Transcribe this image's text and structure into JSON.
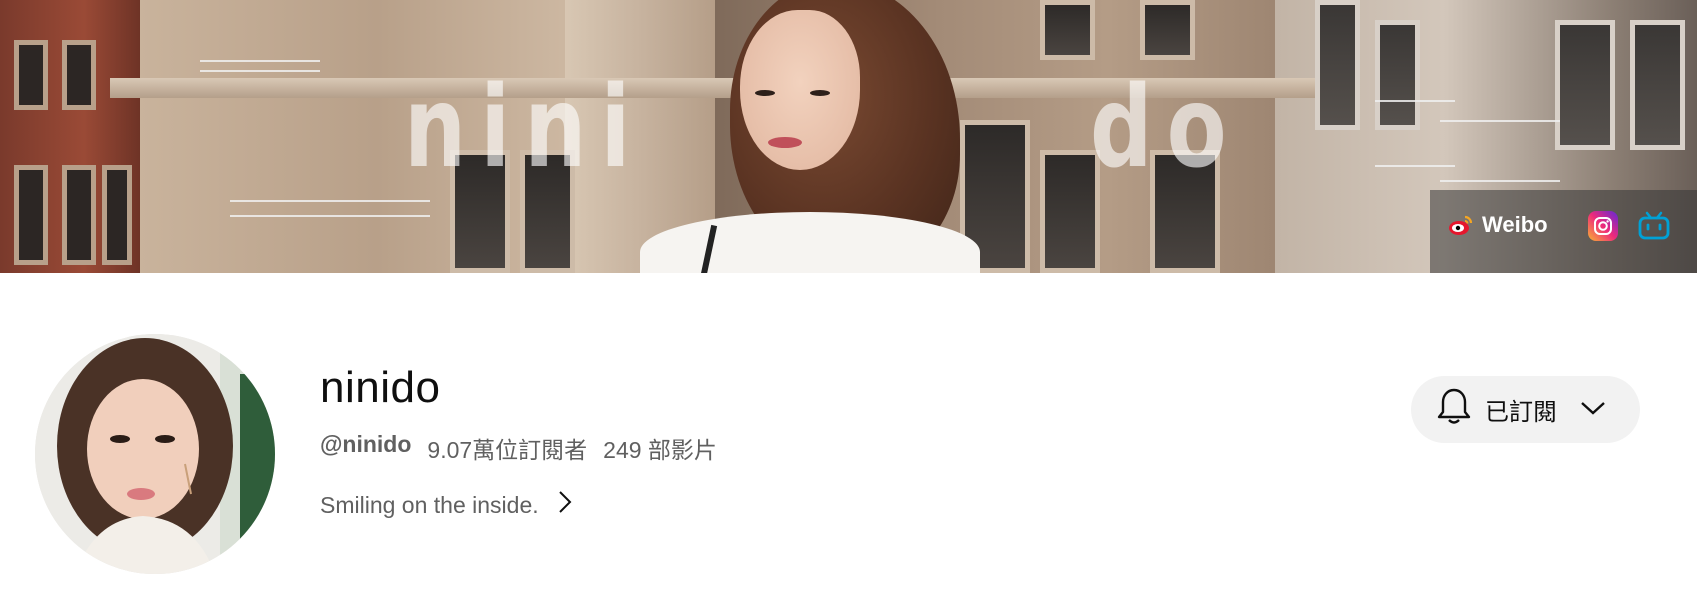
{
  "banner": {
    "word_left": "nini",
    "word_right": "do",
    "links": {
      "weibo_label": "Weibo",
      "weibo_icon": "weibo-icon",
      "instagram_icon": "instagram-icon",
      "bilibili_icon": "bilibili-icon"
    }
  },
  "channel": {
    "name": "ninido",
    "handle": "@ninido",
    "subscribers": "9.07萬位訂閱者",
    "videos": "249 部影片",
    "description": "Smiling on the inside."
  },
  "subscribe": {
    "label": "已訂閱",
    "icon": "bell-icon",
    "chevron": "chevron-down-icon"
  }
}
